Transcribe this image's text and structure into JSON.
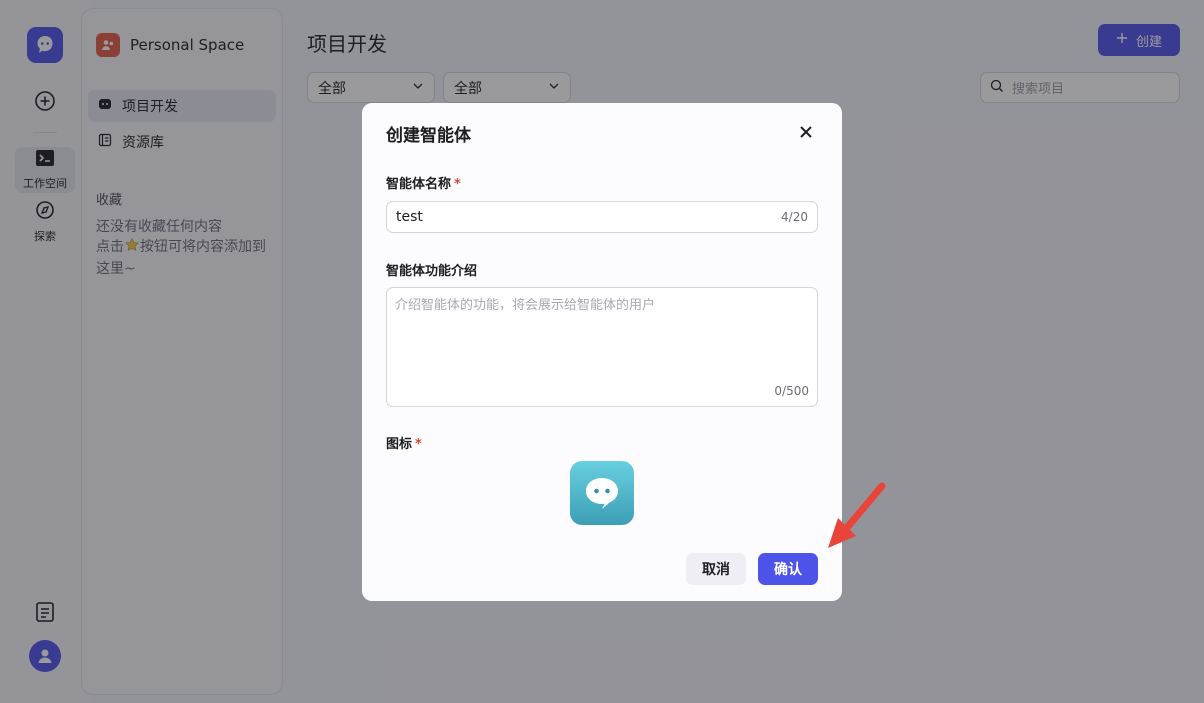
{
  "rail": {
    "nav": [
      {
        "label": "工作空间",
        "icon": "terminal-icon"
      },
      {
        "label": "探索",
        "icon": "compass-icon"
      }
    ]
  },
  "sidebar": {
    "space_name": "Personal Space",
    "items": [
      {
        "label": "项目开发",
        "icon": "bot-icon"
      },
      {
        "label": "资源库",
        "icon": "library-icon"
      }
    ],
    "favorites_title": "收藏",
    "favorites_empty_1": "还没有收藏任何内容",
    "favorites_empty_2a": "点击",
    "favorites_empty_2b": "按钮可将内容添加到",
    "favorites_empty_3": "这里~"
  },
  "main": {
    "title": "项目开发",
    "create_label": "创建",
    "filter_1": "全部",
    "filter_2": "全部",
    "search_placeholder": "搜索项目"
  },
  "modal": {
    "title": "创建智能体",
    "name_label": "智能体名称",
    "name_value": "test",
    "name_counter": "4/20",
    "desc_label": "智能体功能介绍",
    "desc_placeholder": "介绍智能体的功能，将会展示给智能体的用户",
    "desc_counter": "0/500",
    "icon_label": "图标",
    "required_mark": "*",
    "cancel_label": "取消",
    "confirm_label": "确认"
  },
  "colors": {
    "accent": "#4d53e8",
    "required": "#e5452f",
    "arrow": "#e8443a"
  }
}
